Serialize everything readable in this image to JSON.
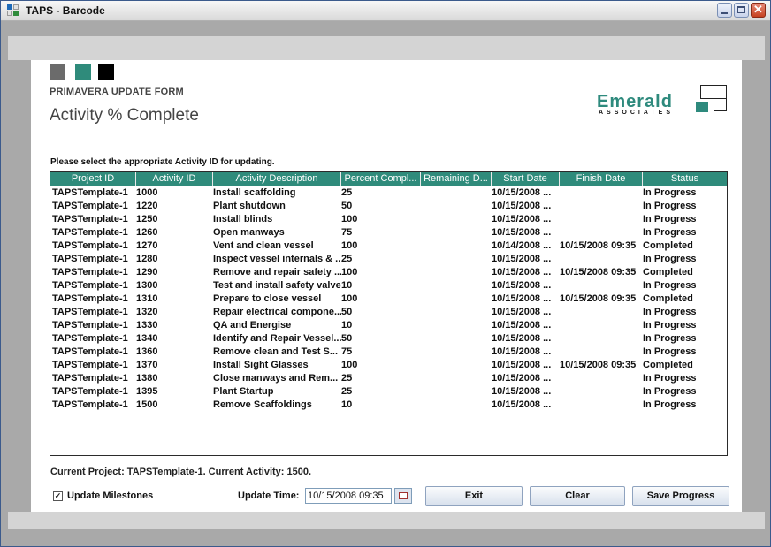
{
  "window": {
    "title": "TAPS - Barcode",
    "controls": {
      "minimize": "minimize-icon",
      "maximize": "maximize-icon",
      "close": "close-icon"
    }
  },
  "branding": {
    "squares": [
      "#6b6b6b",
      "#2f8b7b",
      "#000000"
    ],
    "form_caption": "PRIMAVERA UPDATE FORM",
    "page_title": "Activity % Complete",
    "logo_name": "Emerald",
    "logo_sub": "ASSOCIATES",
    "accent": "#2f8b7b"
  },
  "instruction": "Please select the appropriate Activity ID for updating.",
  "table": {
    "columns": [
      "Project ID",
      "Activity ID",
      "Activity Description",
      "Percent Compl...",
      "Remaining D...",
      "Start Date",
      "Finish Date",
      "Status"
    ],
    "rows": [
      [
        "TAPSTemplate-1",
        "1000",
        "Install scaffolding",
        "25",
        "",
        "10/15/2008 ...",
        "",
        "In Progress"
      ],
      [
        "TAPSTemplate-1",
        "1220",
        "Plant shutdown",
        "50",
        "",
        "10/15/2008 ...",
        "",
        "In Progress"
      ],
      [
        "TAPSTemplate-1",
        "1250",
        "Install blinds",
        "100",
        "",
        "10/15/2008 ...",
        "",
        "In Progress"
      ],
      [
        "TAPSTemplate-1",
        "1260",
        "Open manways",
        "75",
        "",
        "10/15/2008 ...",
        "",
        "In Progress"
      ],
      [
        "TAPSTemplate-1",
        "1270",
        "Vent and clean vessel",
        "100",
        "",
        "10/14/2008 ...",
        "10/15/2008 09:35",
        "Completed"
      ],
      [
        "TAPSTemplate-1",
        "1280",
        "Inspect vessel internals & ...",
        "25",
        "",
        "10/15/2008 ...",
        "",
        "In Progress"
      ],
      [
        "TAPSTemplate-1",
        "1290",
        "Remove and repair safety ...",
        "100",
        "",
        "10/15/2008 ...",
        "10/15/2008 09:35",
        "Completed"
      ],
      [
        "TAPSTemplate-1",
        "1300",
        "Test and install safety valve",
        "10",
        "",
        "10/15/2008 ...",
        "",
        "In Progress"
      ],
      [
        "TAPSTemplate-1",
        "1310",
        "Prepare to close vessel",
        "100",
        "",
        "10/15/2008 ...",
        "10/15/2008 09:35",
        "Completed"
      ],
      [
        "TAPSTemplate-1",
        "1320",
        "Repair electrical compone...",
        "50",
        "",
        "10/15/2008 ...",
        "",
        "In Progress"
      ],
      [
        "TAPSTemplate-1",
        "1330",
        "QA and Energise",
        "10",
        "",
        "10/15/2008 ...",
        "",
        "In Progress"
      ],
      [
        "TAPSTemplate-1",
        "1340",
        "Identify and Repair Vessel...",
        "50",
        "",
        "10/15/2008 ...",
        "",
        "In Progress"
      ],
      [
        "TAPSTemplate-1",
        "1360",
        "Remove  clean and Test S...",
        "75",
        "",
        "10/15/2008 ...",
        "",
        "In Progress"
      ],
      [
        "TAPSTemplate-1",
        "1370",
        "Install Sight Glasses",
        "100",
        "",
        "10/15/2008 ...",
        "10/15/2008 09:35",
        "Completed"
      ],
      [
        "TAPSTemplate-1",
        "1380",
        "Close manways and Rem...",
        "25",
        "",
        "10/15/2008 ...",
        "",
        "In Progress"
      ],
      [
        "TAPSTemplate-1",
        "1395",
        "Plant Startup",
        "25",
        "",
        "10/15/2008 ...",
        "",
        "In Progress"
      ],
      [
        "TAPSTemplate-1",
        "1500",
        "Remove Scaffoldings",
        "10",
        "",
        "10/15/2008 ...",
        "",
        "In Progress"
      ]
    ]
  },
  "status_line": "Current Project: TAPSTemplate-1. Current Activity: 1500.",
  "controls": {
    "update_milestones_label": "Update Milestones",
    "update_milestones_checked": true,
    "update_time_label": "Update Time:",
    "update_time_value": "10/15/2008 09:35",
    "calendar_icon": "calendar-icon",
    "exit_label": "Exit",
    "clear_label": "Clear",
    "save_label": "Save Progress"
  }
}
